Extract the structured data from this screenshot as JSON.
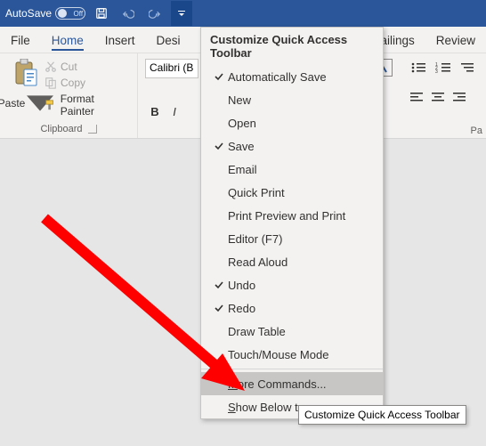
{
  "titlebar": {
    "autosave_label": "AutoSave",
    "autosave_state": "Off"
  },
  "tabs": {
    "file": "File",
    "home": "Home",
    "insert": "Insert",
    "design": "Desi",
    "mailings": "Mailings",
    "review": "Review"
  },
  "clipboard": {
    "paste": "Paste",
    "cut": "Cut",
    "copy": "Copy",
    "format_painter": "Format Painter",
    "group_label": "Clipboard"
  },
  "font": {
    "font_name": "Calibri (B",
    "bold": "B",
    "italic": "I"
  },
  "paragraph_label": "Pa",
  "dropdown": {
    "title": "Customize Quick Access Toolbar",
    "items": [
      {
        "label": "Automatically Save",
        "checked": true
      },
      {
        "label": "New",
        "checked": false
      },
      {
        "label": "Open",
        "checked": false
      },
      {
        "label": "Save",
        "checked": true
      },
      {
        "label": "Email",
        "checked": false
      },
      {
        "label": "Quick Print",
        "checked": false
      },
      {
        "label": "Print Preview and Print",
        "checked": false
      },
      {
        "label": "Editor (F7)",
        "checked": false
      },
      {
        "label": "Read Aloud",
        "checked": false
      },
      {
        "label": "Undo",
        "checked": true
      },
      {
        "label": "Redo",
        "checked": true
      },
      {
        "label": "Draw Table",
        "checked": false
      },
      {
        "label": "Touch/Mouse Mode",
        "checked": false
      }
    ],
    "more_commands_pre": "M",
    "more_commands_post": "ore Commands...",
    "show_below_pre": "S",
    "show_below_post": "how Below t"
  },
  "tooltip": "Customize Quick Access Toolbar"
}
